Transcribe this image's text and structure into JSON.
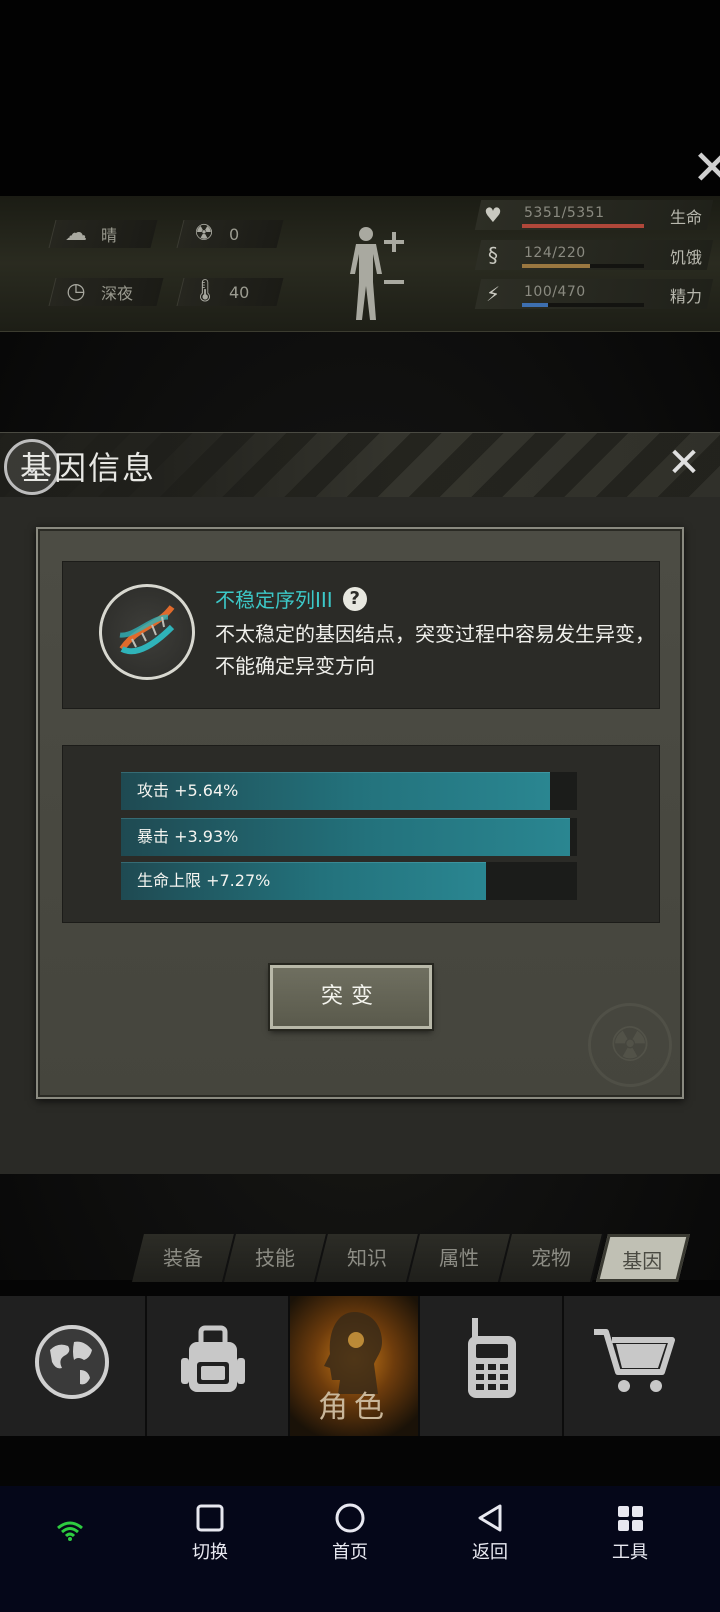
{
  "status": {
    "weather": "晴",
    "radiation": "0",
    "time_of_day": "深夜",
    "temperature": "40",
    "stats": [
      {
        "value": "5351/5351",
        "label": "生命",
        "fraction": 1.0,
        "color": "#b0473a",
        "icon": "heart-pulse-icon"
      },
      {
        "value": "124/220",
        "label": "饥饿",
        "fraction": 0.56,
        "color": "#9a7740",
        "icon": "stomach-icon"
      },
      {
        "value": "100/470",
        "label": "精力",
        "fraction": 0.21,
        "color": "#3d6fb0",
        "icon": "energy-icon"
      }
    ]
  },
  "modal": {
    "title": "基因信息",
    "gene_name": "不稳定序列III",
    "gene_description": "不太稳定的基因结点，突变过程中容易发生异变，不能确定异变方向",
    "bonuses": [
      {
        "label": "攻击 +5.64%",
        "fraction": 0.94
      },
      {
        "label": "暴击 +3.93%",
        "fraction": 0.985
      },
      {
        "label": "生命上限 +7.27%",
        "fraction": 0.8
      }
    ],
    "mutate_button": "突变"
  },
  "tabs": [
    "装备",
    "技能",
    "知识",
    "属性",
    "宠物",
    "基因"
  ],
  "active_tab": "基因",
  "bottom_nav": {
    "role_label": "角色"
  },
  "system_nav": {
    "switch": "切换",
    "home": "首页",
    "back": "返回",
    "tools": "工具"
  },
  "colors": {
    "accent_teal": "#3cc8c8",
    "bar_teal": "#23727c",
    "role_glow": "#c87a18"
  }
}
